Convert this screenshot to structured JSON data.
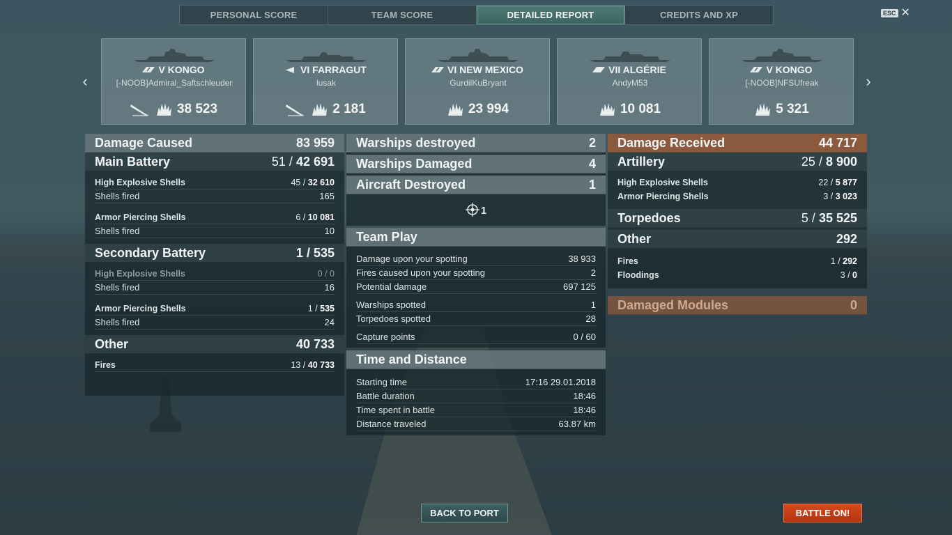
{
  "tabs": [
    "PERSONAL SCORE",
    "TEAM SCORE",
    "DETAILED REPORT",
    "CREDITS AND XP"
  ],
  "active_tab": "DETAILED REPORT",
  "esc_label": "ESC",
  "close_glyph": "✕",
  "nav": {
    "prev_glyph": "‹",
    "next_glyph": "›"
  },
  "ships": [
    {
      "tier_name": "V KONGO",
      "player": "[-NOOB]Admiral_Saftschleuder",
      "damage": "38 523",
      "has_torpedo": true
    },
    {
      "tier_name": "VI FARRAGUT",
      "player": "lusak",
      "damage": "2 181",
      "has_torpedo": true
    },
    {
      "tier_name": "VI NEW MEXICO",
      "player": "GurdilKuBryant",
      "damage": "23 994",
      "has_torpedo": false
    },
    {
      "tier_name": "VII ALGÉRIE",
      "player": "AndyM53",
      "damage": "10 081",
      "has_torpedo": false
    },
    {
      "tier_name": "V KONGO",
      "player": "[-NOOB]NFSUfreak",
      "damage": "5 321",
      "has_torpedo": false
    }
  ],
  "damage_caused": {
    "title": "Damage Caused",
    "total": "83 959",
    "main_battery": {
      "label": "Main Battery",
      "hits": "51",
      "dmg": "42 691",
      "he": {
        "label": "High Explosive Shells",
        "hits": "45",
        "dmg": "32 610",
        "fired_label": "Shells fired",
        "fired": "165"
      },
      "ap": {
        "label": "Armor Piercing Shells",
        "hits": "6",
        "dmg": "10 081",
        "fired_label": "Shells fired",
        "fired": "10"
      }
    },
    "secondary": {
      "label": "Secondary Battery",
      "hits": "1",
      "dmg": "535",
      "he": {
        "label": "High Explosive Shells",
        "hits": "0",
        "dmg": "0",
        "fired_label": "Shells fired",
        "fired": "16"
      },
      "ap": {
        "label": "Armor Piercing Shells",
        "hits": "1",
        "dmg": "535",
        "fired_label": "Shells fired",
        "fired": "24"
      }
    },
    "other": {
      "label": "Other",
      "total": "40 733",
      "fires": {
        "label": "Fires",
        "hits": "13",
        "dmg": "40 733"
      }
    }
  },
  "middle": {
    "warships_destroyed": {
      "label": "Warships destroyed",
      "value": "2"
    },
    "warships_damaged": {
      "label": "Warships Damaged",
      "value": "4"
    },
    "aircraft_destroyed": {
      "label": "Aircraft Destroyed",
      "value": "1"
    },
    "aircraft_icon_count": "1",
    "team_play": {
      "title": "Team Play",
      "rows": [
        {
          "label": "Damage upon your spotting",
          "value": "38 933"
        },
        {
          "label": "Fires caused upon your spotting",
          "value": "2"
        },
        {
          "label": "Potential damage",
          "value": "697 125"
        },
        {
          "label": "Warships spotted",
          "value": "1"
        },
        {
          "label": "Torpedoes spotted",
          "value": "28"
        },
        {
          "label": "Capture points",
          "value": "0 / 60"
        }
      ]
    },
    "time_distance": {
      "title": "Time and Distance",
      "rows": [
        {
          "label": "Starting time",
          "value": "17:16  29.01.2018"
        },
        {
          "label": "Battle duration",
          "value": "18:46"
        },
        {
          "label": "Time spent in battle",
          "value": "18:46"
        },
        {
          "label": "Distance traveled",
          "value": "63.87 km"
        }
      ]
    }
  },
  "damage_received": {
    "title": "Damage Received",
    "total": "44 717",
    "artillery": {
      "label": "Artillery",
      "hits": "25",
      "dmg": "8 900",
      "he": {
        "label": "High Explosive Shells",
        "hits": "22",
        "dmg": "5 877"
      },
      "ap": {
        "label": "Armor Piercing Shells",
        "hits": "3",
        "dmg": "3 023"
      }
    },
    "torpedoes": {
      "label": "Torpedoes",
      "hits": "5",
      "dmg": "35 525"
    },
    "other": {
      "label": "Other",
      "total": "292",
      "fires": {
        "label": "Fires",
        "hits": "1",
        "dmg": "292"
      },
      "floodings": {
        "label": "Floodings",
        "hits": "3",
        "dmg": "0"
      }
    },
    "modules": {
      "label": "Damaged Modules",
      "value": "0"
    }
  },
  "buttons": {
    "back": "BACK TO PORT",
    "battle": "BATTLE ON!"
  },
  "colors": {
    "accent_teal": "#3d6561",
    "received_orange": "#8b5a3e",
    "battle_red": "#d64a1c"
  }
}
